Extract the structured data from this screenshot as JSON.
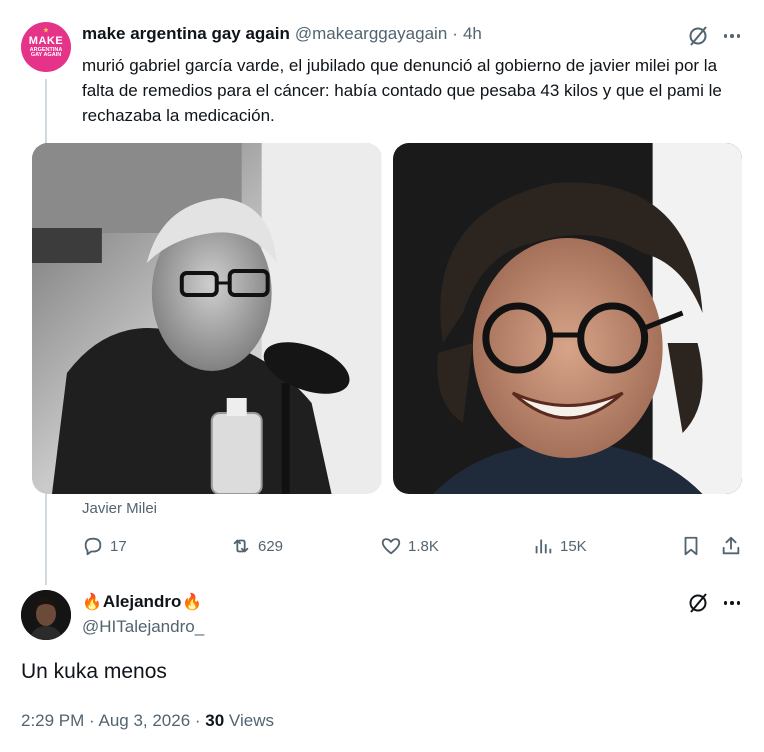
{
  "parent_tweet": {
    "avatar_text": [
      "MAKE",
      "ARGENTINA",
      "GAY AGAIN"
    ],
    "author_name": "make argentina gay again",
    "handle": "@makearggayagain",
    "separator": "·",
    "time": "4h",
    "text": "murió gabriel garcía varde, el jubilado que denunció al gobierno de javier milei por la falta de remedios para el cáncer: había contado que pesaba 43 kilos y que el pami le rechazaba la medicación.",
    "media_caption": "Javier Milei",
    "stats": {
      "replies": "17",
      "reposts": "629",
      "likes": "1.8K",
      "views": "15K"
    }
  },
  "reply": {
    "author_name": "Alejandro",
    "name_emoji": "🔥",
    "handle": "@HITalejandro_",
    "text": "Un kuka menos",
    "timestamp": "2:29 PM · Aug 3, 2026 · ",
    "views_count": "30",
    "views_label": " Views"
  },
  "colors": {
    "text_primary": "#0f1419",
    "text_secondary": "#536471",
    "thread_line": "#cfd9de",
    "avatar_pink": "#e6338a"
  },
  "icons": [
    "grok-icon",
    "more-icon",
    "reply-icon",
    "repost-icon",
    "like-icon",
    "views-icon",
    "bookmark-icon",
    "share-icon"
  ]
}
